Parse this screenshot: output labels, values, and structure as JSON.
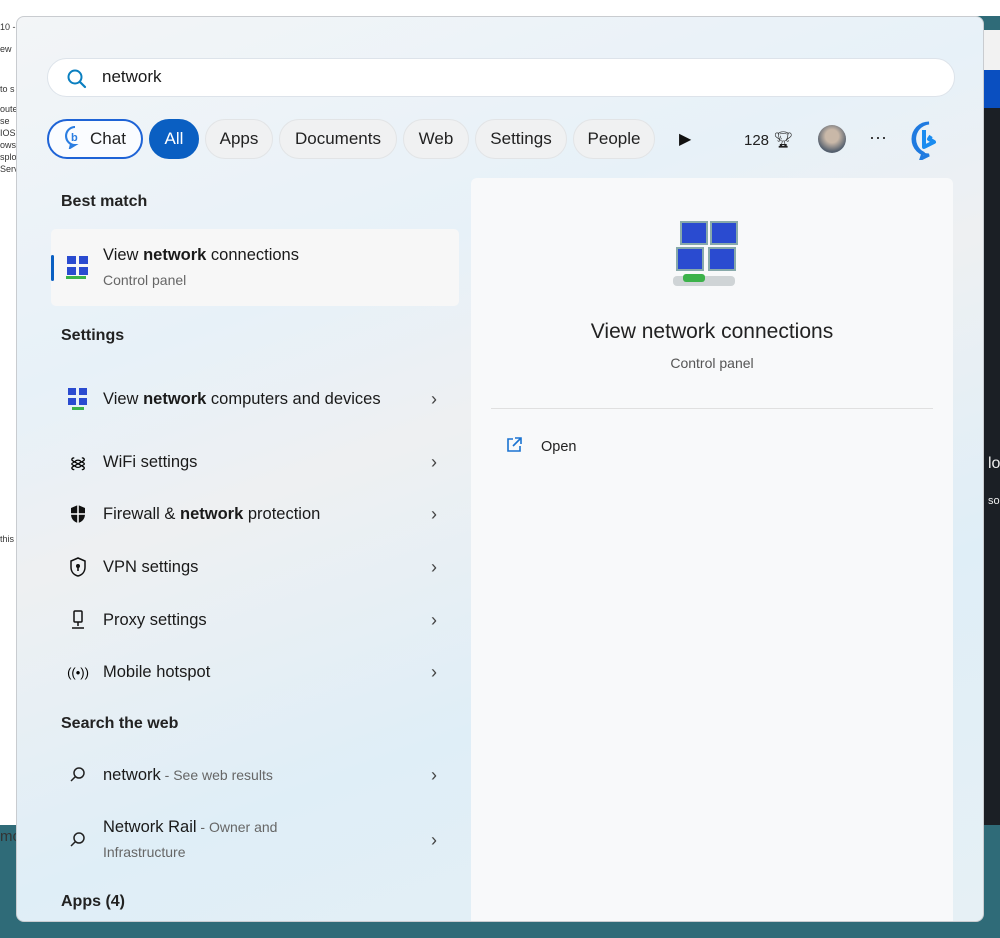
{
  "background": {
    "left_fragments": [
      "10 -",
      "ew",
      "to s",
      "oute",
      "se",
      "IOS",
      "ows_",
      "splo",
      "Serv_",
      "this",
      "mo"
    ],
    "right_fragments": [
      "lo",
      "so"
    ]
  },
  "search": {
    "value": "network"
  },
  "filters": {
    "chat": "Chat",
    "items": [
      "All",
      "Apps",
      "Documents",
      "Web",
      "Settings",
      "People"
    ],
    "active": "All",
    "points": "128"
  },
  "best_match": {
    "header": "Best match",
    "item": {
      "pre": "View ",
      "bold": "network",
      "post": " connections",
      "sub": "Control panel"
    }
  },
  "settings": {
    "header": "Settings",
    "items": [
      {
        "pre": "View ",
        "bold": "network",
        "post": " computers and devices",
        "icon": "network-computers-icon"
      },
      {
        "pre": "WiFi settings",
        "bold": "",
        "post": "",
        "icon": "wifi-icon"
      },
      {
        "pre": "Firewall & ",
        "bold": "network",
        "post": " protection",
        "icon": "shield-icon"
      },
      {
        "pre": "VPN settings",
        "bold": "",
        "post": "",
        "icon": "vpn-shield-icon"
      },
      {
        "pre": "Proxy settings",
        "bold": "",
        "post": "",
        "icon": "proxy-icon"
      },
      {
        "pre": "Mobile hotspot",
        "bold": "",
        "post": "",
        "icon": "hotspot-icon"
      }
    ]
  },
  "web": {
    "header": "Search the web",
    "items": [
      {
        "main": "network",
        "sub": " - See web results"
      },
      {
        "main": "Network Rail",
        "sub": " - Owner and Infrastructure"
      }
    ]
  },
  "apps": {
    "header": "Apps (4)"
  },
  "preview": {
    "title": "View network connections",
    "sub": "Control panel",
    "open": "Open"
  }
}
